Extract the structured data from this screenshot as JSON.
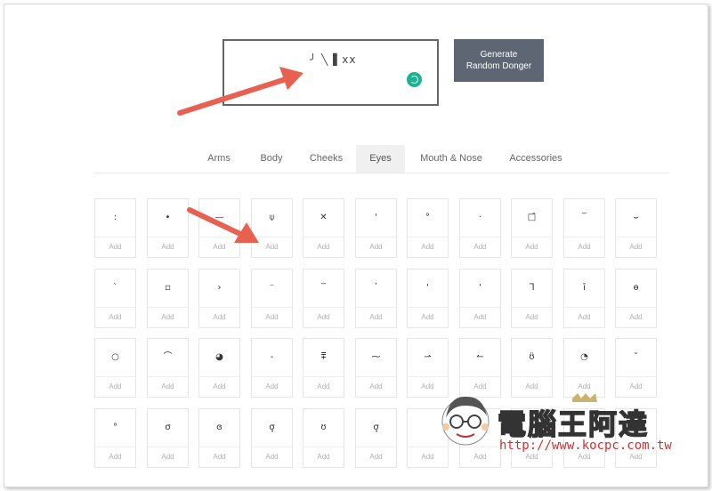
{
  "preview": {
    "text": "╯ ╲ ▌ⅹⅹ"
  },
  "generate_button": {
    "label": "Generate\nRandom Donger"
  },
  "tabs": [
    {
      "label": "Arms",
      "active": false
    },
    {
      "label": "Body",
      "active": false
    },
    {
      "label": "Cheeks",
      "active": false
    },
    {
      "label": "Eyes",
      "active": true
    },
    {
      "label": "Mouth & Nose",
      "active": false
    },
    {
      "label": "Accessories",
      "active": false
    }
  ],
  "add_label": "Add",
  "eye_rows": [
    [
      ":",
      "•",
      "—",
      "⍦",
      "✕",
      "'",
      "°",
      "·",
      "□̄",
      "‾",
      "⌣"
    ],
    [
      "`",
      "▫",
      "›",
      "⁻",
      "‾",
      "᾿",
      "'",
      "'",
      "ᒣ",
      "ī",
      "ɵ"
    ],
    [
      "○",
      "⌒",
      "◕",
      "-",
      "⩱",
      "⁓",
      "⇀",
      "↼",
      "ʊ̈",
      "◔",
      "ˇ"
    ],
    [
      "°",
      "σ",
      "ɞ",
      "σ̥",
      "ʊ",
      "σ̥",
      "",
      "",
      "",
      "",
      ""
    ]
  ],
  "accent_colors": {
    "loader": "#1ab394",
    "arrow": "#e8604f",
    "button": "#5f6673"
  },
  "watermark": {
    "title": "電腦王阿達",
    "url": "http://www.kocpc.com.tw"
  }
}
